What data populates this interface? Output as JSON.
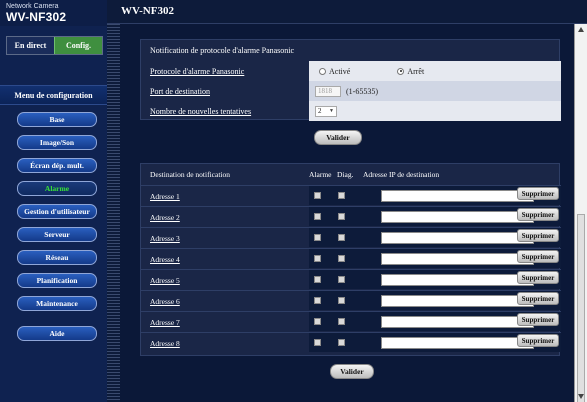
{
  "brand": {
    "line1": "Network Camera",
    "line2": "WV-NF302"
  },
  "header": {
    "model": "WV-NF302"
  },
  "mode_tabs": {
    "live": "En direct",
    "config": "Config."
  },
  "menu": {
    "title": "Menu de configuration",
    "items": [
      {
        "label": "Base",
        "active": false
      },
      {
        "label": "Image/Son",
        "active": false
      },
      {
        "label": "Écran dép. mult.",
        "active": false
      },
      {
        "label": "Alarme",
        "active": true
      },
      {
        "label": "Gestion d'utilisateur",
        "active": false
      },
      {
        "label": "Serveur",
        "active": false
      },
      {
        "label": "Réseau",
        "active": false
      },
      {
        "label": "Planification",
        "active": false
      },
      {
        "label": "Maintenance",
        "active": false
      },
      {
        "label": "Aide",
        "active": false
      }
    ]
  },
  "section1": {
    "title": "Notification de protocole d'alarme Panasonic",
    "protocol": {
      "label": "Protocole d'alarme Panasonic",
      "on": "Activé",
      "off": "Arrêt",
      "selected": "off"
    },
    "port": {
      "label": "Port de destination",
      "value": "1818",
      "range": "(1-65535)"
    },
    "retries": {
      "label": "Nombre de nouvelles tentatives",
      "value": "2"
    },
    "submit": "Valider"
  },
  "section2": {
    "headers": {
      "destination": "Destination de notification",
      "alarm": "Alarme",
      "diag": "Diag.",
      "ip": "Adresse IP de destination"
    },
    "rows": [
      {
        "label": "Adresse 1",
        "delete": "Supprimer"
      },
      {
        "label": "Adresse 2",
        "delete": "Supprimer"
      },
      {
        "label": "Adresse 3",
        "delete": "Supprimer"
      },
      {
        "label": "Adresse 4",
        "delete": "Supprimer"
      },
      {
        "label": "Adresse 5",
        "delete": "Supprimer"
      },
      {
        "label": "Adresse 6",
        "delete": "Supprimer"
      },
      {
        "label": "Adresse 7",
        "delete": "Supprimer"
      },
      {
        "label": "Adresse 8",
        "delete": "Supprimer"
      }
    ],
    "submit": "Valider"
  },
  "colors": {
    "accent_green": "#37e337",
    "config_tab": "#3f8f3f",
    "menu_button": "#1f4ea8",
    "background": "#0d1b3a"
  }
}
